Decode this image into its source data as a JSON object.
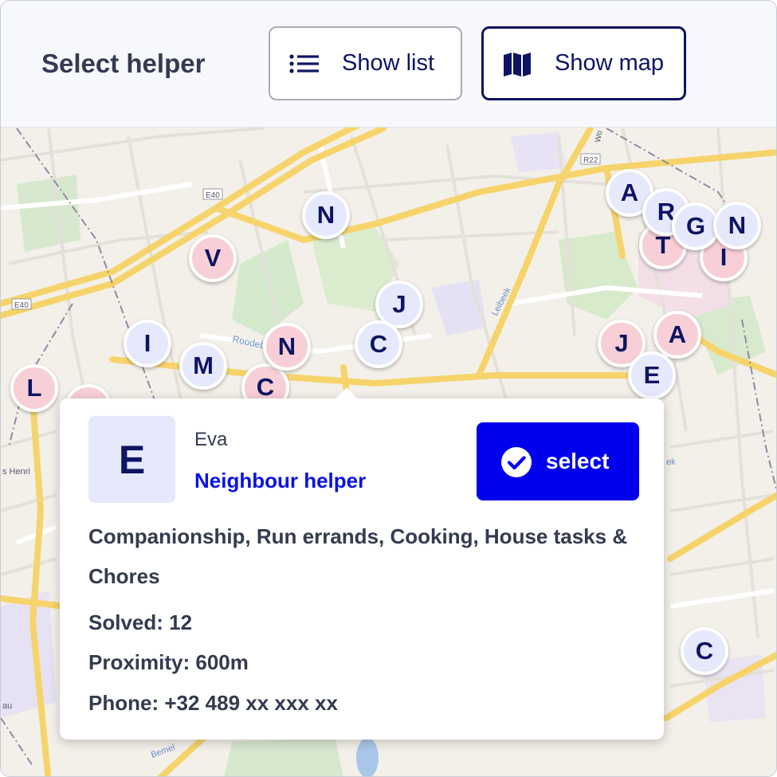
{
  "header": {
    "title": "Select helper",
    "show_list_label": "Show list",
    "show_map_label": "Show map"
  },
  "map": {
    "road_labels": [
      "E40",
      "E40",
      "R22",
      "Roodebeek",
      "Leibeek",
      "s Henri",
      "Bemel",
      "au",
      "ek",
      "Wo"
    ],
    "markers": [
      {
        "letter": "A",
        "style": "blue"
      },
      {
        "letter": "T",
        "style": "pink"
      },
      {
        "letter": "R",
        "style": "blue"
      },
      {
        "letter": "I",
        "style": "pink"
      },
      {
        "letter": "G",
        "style": "blue"
      },
      {
        "letter": "N",
        "style": "blue"
      },
      {
        "letter": "N",
        "style": "blue"
      },
      {
        "letter": "V",
        "style": "pink"
      },
      {
        "letter": "J",
        "style": "blue"
      },
      {
        "letter": "C",
        "style": "blue"
      },
      {
        "letter": "I",
        "style": "blue"
      },
      {
        "letter": "M",
        "style": "blue"
      },
      {
        "letter": "C",
        "style": "pink"
      },
      {
        "letter": "N",
        "style": "pink"
      },
      {
        "letter": "L",
        "style": "pink"
      },
      {
        "letter": "J",
        "style": "pink"
      },
      {
        "letter": "A",
        "style": "pink"
      },
      {
        "letter": "E",
        "style": "blue"
      },
      {
        "letter": "C",
        "style": "blue"
      }
    ]
  },
  "popup": {
    "avatar_letter": "E",
    "name": "Eva",
    "role": "Neighbour helper",
    "select_label": "select",
    "services": "Companionship, Run errands, Cooking, House tasks & Chores",
    "solved": "Solved: 12",
    "proximity": "Proximity: 600m",
    "phone": "Phone: +32 489 xx xxx xx"
  },
  "colors": {
    "accent": "#0000ee",
    "navy": "#0e1463",
    "text": "#343a50",
    "marker_blue": "#e6e8fb",
    "marker_pink": "#f8cfd6"
  }
}
